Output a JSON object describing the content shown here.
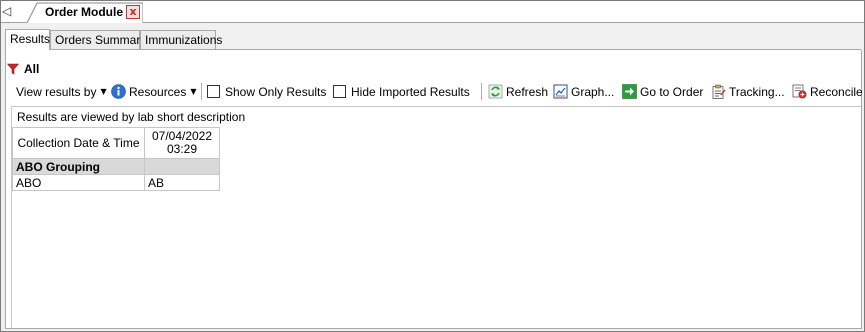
{
  "doc_tab": {
    "title": "Order Module",
    "close_glyph": "x"
  },
  "strip_mark": "◁",
  "sub_tabs": [
    {
      "label": "Results",
      "active": true
    },
    {
      "label": "Orders Summary",
      "active": false
    },
    {
      "label": "Immunizations",
      "active": false
    }
  ],
  "filter": {
    "label": "All"
  },
  "toolbar": {
    "view_results_by": "View results by",
    "resources": "Resources",
    "show_only_results": "Show Only Results",
    "hide_imported_results": "Hide Imported Results",
    "refresh": "Refresh",
    "graph": "Graph...",
    "go_to_order": "Go to Order",
    "tracking": "Tracking...",
    "reconcile": "Reconcile"
  },
  "grid": {
    "caption": "Results are viewed by lab short description",
    "header_label": "Collection Date & Time",
    "columns": [
      {
        "date": "07/04/2022",
        "time": "03:29"
      }
    ],
    "groups": [
      {
        "name": "ABO Grouping",
        "rows": [
          {
            "label": "ABO",
            "values": [
              "AB"
            ]
          }
        ]
      }
    ]
  },
  "colors": {
    "accent_red": "#c62828",
    "group_bg": "#d9d9d9",
    "info_blue": "#2f6fd1",
    "refresh_green": "#2e9b3e"
  }
}
